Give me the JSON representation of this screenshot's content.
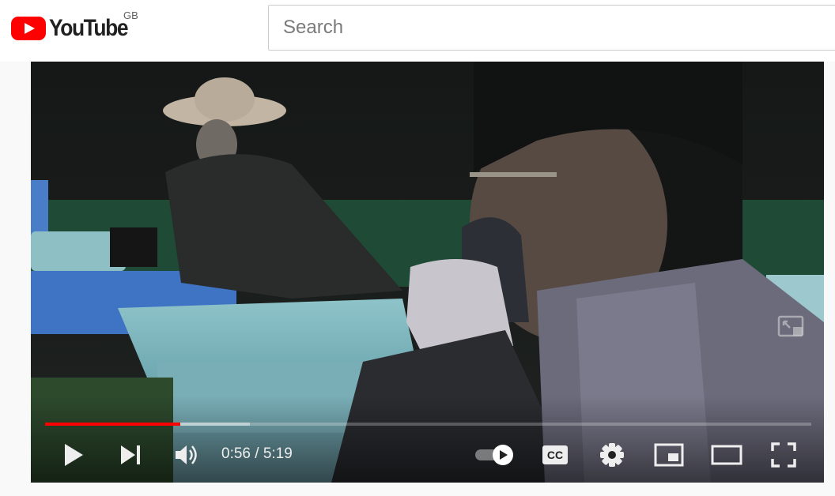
{
  "header": {
    "logo_text": "YouTube",
    "region": "GB",
    "search_placeholder": "Search"
  },
  "player": {
    "current_time": "0:56",
    "duration": "5:19",
    "time_display": "0:56 / 5:19",
    "progress_fraction": 0.176,
    "buffered_fraction": 0.267,
    "autoplay": "on",
    "colors": {
      "played": "#ff0000",
      "brand": "#ff0000"
    }
  },
  "icons": [
    "play-icon",
    "next-icon",
    "volume-icon",
    "autoplay-toggle-icon",
    "captions-icon",
    "settings-icon",
    "miniplayer-icon",
    "theater-mode-icon",
    "fullscreen-icon",
    "expand-icon"
  ]
}
